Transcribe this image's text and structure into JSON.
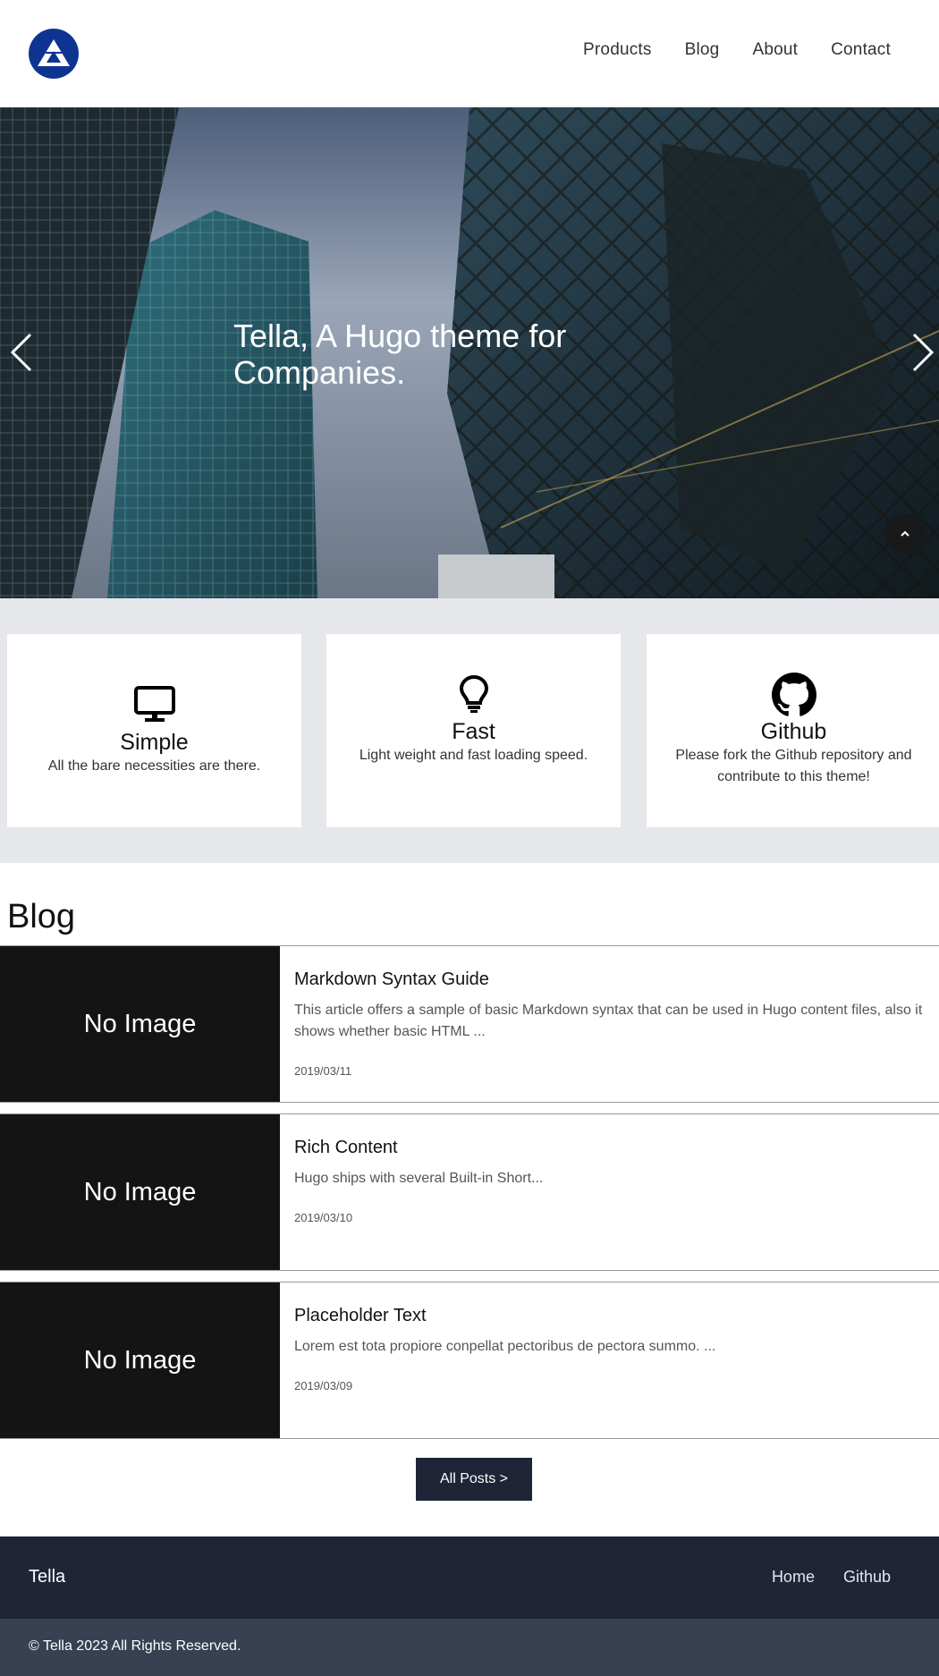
{
  "header": {
    "nav": [
      "Products",
      "Blog",
      "About",
      "Contact"
    ]
  },
  "hero": {
    "title": "Tella, A Hugo theme for Companies."
  },
  "features": [
    {
      "icon": "monitor-icon",
      "title": "Simple",
      "text": "All the bare necessities are there."
    },
    {
      "icon": "lightbulb-icon",
      "title": "Fast",
      "text": "Light weight and fast loading speed."
    },
    {
      "icon": "github-icon",
      "title": "Github",
      "text": "Please fork the Github repository and contribute to this theme!"
    }
  ],
  "blog": {
    "heading": "Blog",
    "posts": [
      {
        "thumb": "No Image",
        "title": "Markdown Syntax Guide",
        "excerpt": "This article offers a sample of basic Markdown syntax that can be used in Hugo content files, also it shows whether basic HTML ...",
        "date": "2019/03/11"
      },
      {
        "thumb": "No Image",
        "title": "Rich Content",
        "excerpt": "Hugo ships with several Built-in Short...",
        "date": "2019/03/10"
      },
      {
        "thumb": "No Image",
        "title": "Placeholder Text",
        "excerpt": "Lorem est tota propiore conpellat pectoribus de pectora summo. ...",
        "date": "2019/03/09"
      }
    ],
    "all_posts_label": "All Posts >"
  },
  "footer": {
    "brand": "Tella",
    "links": [
      "Home",
      "Github"
    ],
    "copyright": "© Tella 2023 All Rights Reserved."
  },
  "colors": {
    "brand_blue": "#0d3490",
    "footer_dark": "#1f2537",
    "footer_bottom": "#374152",
    "features_bg": "#e5e7eb"
  }
}
